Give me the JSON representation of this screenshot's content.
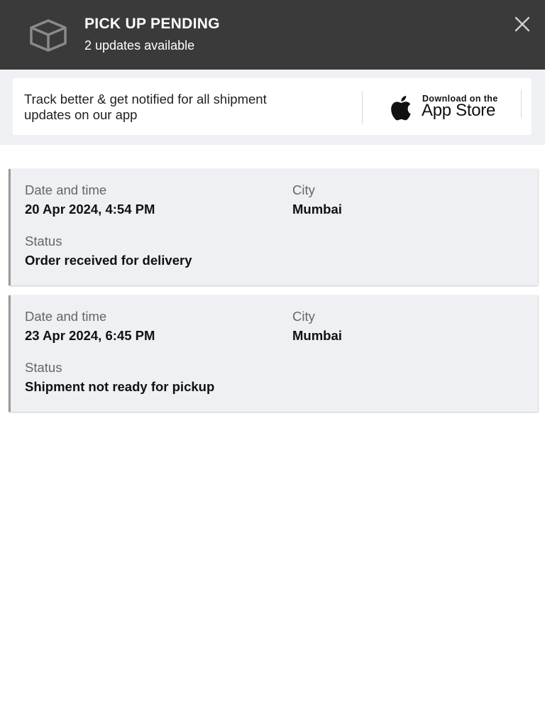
{
  "header": {
    "icon": "package-box-icon",
    "title": "PICK UP PENDING",
    "subtitle": "2 updates available",
    "close_icon": "close-icon"
  },
  "promo": {
    "text": "Track better & get notified for all shipment updates on our app",
    "badge": {
      "icon": "apple-logo-icon",
      "small_text": "Download on the",
      "big_text": "App Store"
    }
  },
  "events": [
    {
      "date_label": "Date and time",
      "date_value": "20 Apr 2024, 4:54 PM",
      "city_label": "City",
      "city_value": "Mumbai",
      "status_label": "Status",
      "status_value": "Order received for delivery"
    },
    {
      "date_label": "Date and time",
      "date_value": "23 Apr 2024, 6:45 PM",
      "city_label": "City",
      "city_value": "Mumbai",
      "status_label": "Status",
      "status_value": "Shipment not ready for pickup"
    }
  ],
  "colors": {
    "header_bg": "#3a3a3a",
    "promo_band_bg": "#f0f1f4",
    "card_bg": "#eff0f4"
  }
}
